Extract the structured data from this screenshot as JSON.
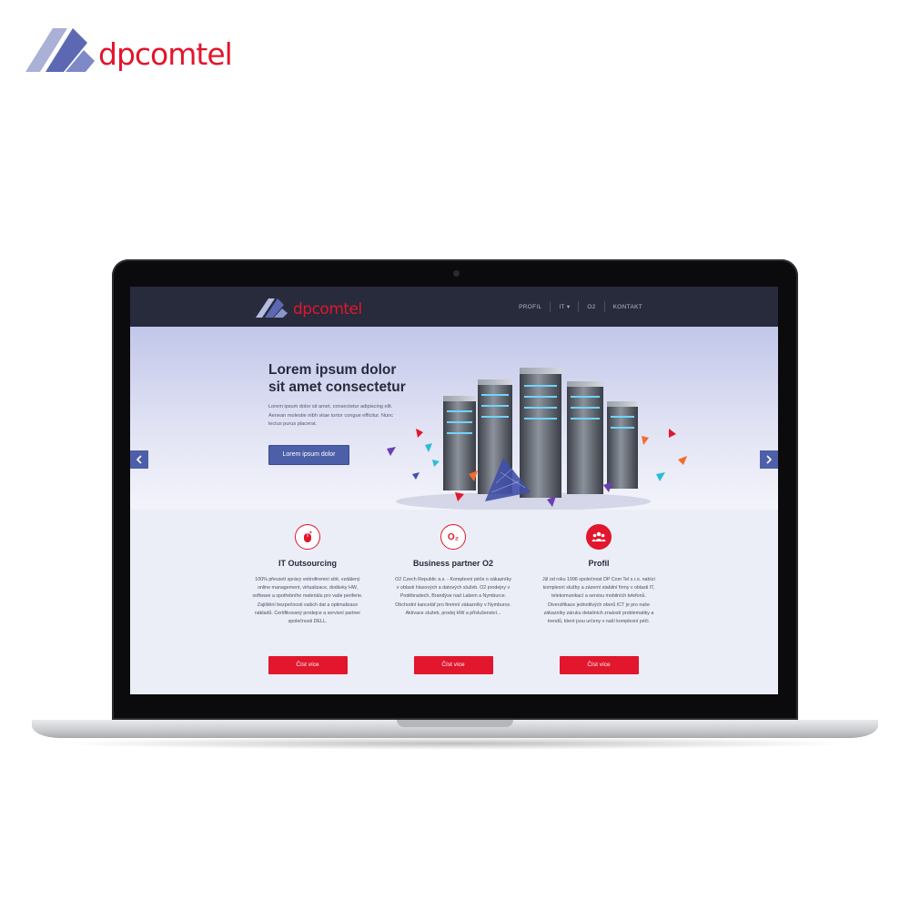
{
  "brand": {
    "name": "dpcomtel"
  },
  "site": {
    "logo_text": "dpcomtel",
    "nav": [
      {
        "label": "PROFIL"
      },
      {
        "label": "IT ▾"
      },
      {
        "label": "O2"
      },
      {
        "label": "KONTAKT"
      }
    ],
    "hero": {
      "title_line1": "Lorem ipsum dolor",
      "title_line2": "sit amet consectetur",
      "text": "Lorem ipsum dolor sit amet, consectetur adipiscing elit. Aenean molestie nibh vitae tortor congue efficitur. Nunc lectus purus placerat.",
      "cta_label": "Lorem ipsum dolor",
      "prev_icon": "chevron-left-icon",
      "next_icon": "chevron-right-icon"
    },
    "features": [
      {
        "icon": "mouse-icon",
        "title": "IT Outsourcing",
        "text": "100% převzetí správy vnitrofiremní sítě, vzdálený online management, virtualizace, dodávky HW, software a spotřebního materiálu pro vaše periferie. Zajištění bezpečnosti vašich dat a optimalizace nákladů. Certifikovaný prodejce a servisní partner společnosti DELL.",
        "button": "Číst více"
      },
      {
        "icon": "o2-icon",
        "icon_text": "O₂",
        "title": "Business partner O2",
        "text": "O2 Czech Republic a.s. - Komplexní péče o zákazníky v oblasti hlasových a datových služeb. O2 prodejny v Poděbradech, Brandýse nad Labem a Nymburce. Obchodní kancelář pro firemní zákazníky v Nymburce. Aktivace služeb, prodej HW a příslušenství...",
        "button": "Číst více"
      },
      {
        "icon": "people-icon",
        "title": "Profil",
        "text": "Již od roku 1996 společnost DP Com Tel s.r.o. nabízí komplexní služby a zázemí stabilní firmy v oblasti IT, telekomunikací a servisu mobilních telefonů. Diverzifikace jednotlivých oborů ICT je pro naše zákazníky záruku detailních znalostí problematiky a trendů, které jsou určeny v naší komplexní péči.",
        "button": "Číst více"
      }
    ]
  },
  "colors": {
    "brand_red": "#e2162c",
    "brand_blue": "#4d5fa8",
    "header_dark": "#272b3b"
  }
}
